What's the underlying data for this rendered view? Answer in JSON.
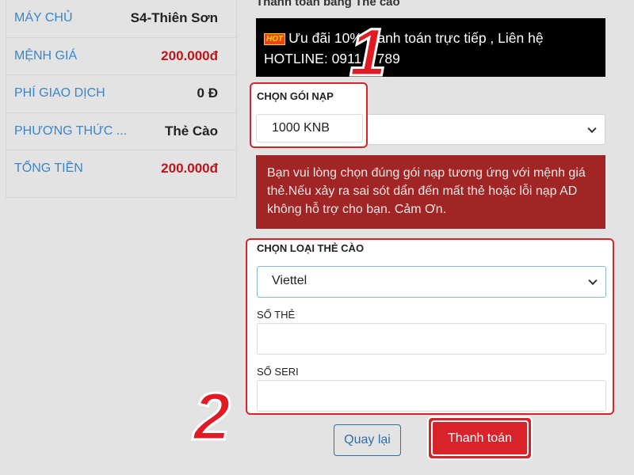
{
  "summary": {
    "rows": [
      {
        "key": "MÁY CHỦ",
        "value": "S4-Thiên Sơn"
      },
      {
        "key": "MỆNH GIÁ",
        "value": "200.000đ"
      },
      {
        "key": "PHÍ GIAO DỊCH",
        "value": "0 Đ"
      },
      {
        "key": "PHƯƠNG THỨC ...",
        "value": "Thẻ Cào"
      },
      {
        "key": "TỔNG TIỀN",
        "value": "200.000đ"
      }
    ]
  },
  "form": {
    "section_title": "Thanh toán bằng Thẻ cào",
    "promo": {
      "badge": "HOT",
      "text": "Ưu đãi 10% thanh toán trực tiếp , Liên hệ HOTLINE: 0911.5 789"
    },
    "package": {
      "label": "CHỌN GÓI NẠP",
      "selected": "1000 KNB"
    },
    "warning": "Bạn vui lòng chọn đúng gói nạp tương ứng với mệnh giá thẻ.Nếu xảy ra sai sót dẩn đến mất thẻ hoặc lỗi nạp AD không hỗ trợ cho bạn. Cảm Ơn.",
    "card_type": {
      "label": "CHỌN LOẠI THẺ CÀO",
      "selected": "Viettel"
    },
    "card_number": {
      "label": "SỐ THẺ",
      "value": ""
    },
    "serial": {
      "label": "SỐ SERI",
      "value": ""
    },
    "back_button": "Quay lại",
    "pay_button": "Thanh toán"
  },
  "annotations": {
    "step1": "1",
    "step2": "2"
  },
  "colors": {
    "accent_red": "#d8232a",
    "key_blue": "#3a86c8",
    "warning_bg": "#a22525"
  }
}
